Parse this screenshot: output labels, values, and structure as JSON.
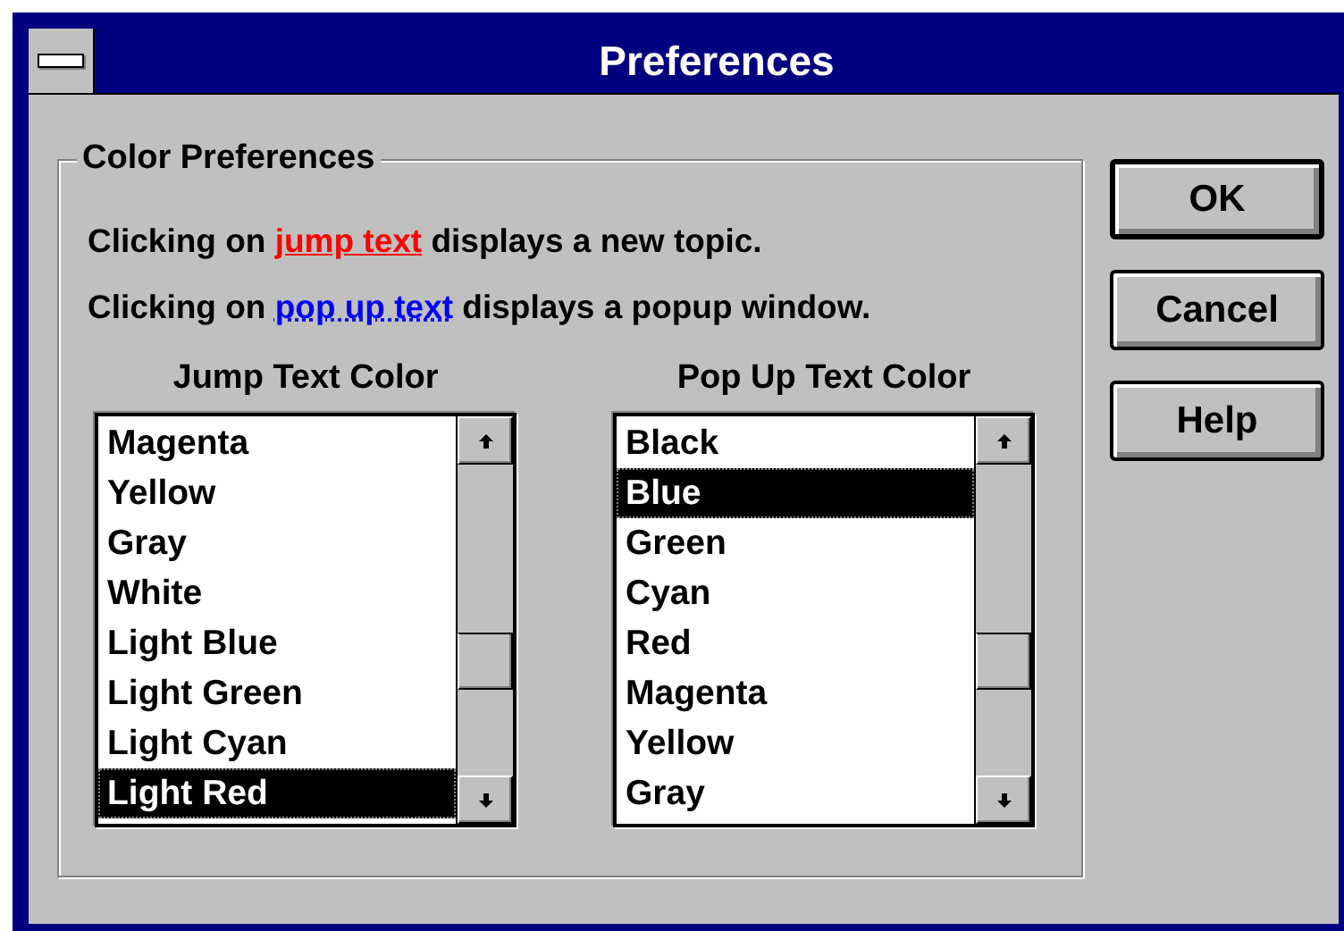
{
  "window": {
    "title": "Preferences"
  },
  "group": {
    "title": "Color Preferences"
  },
  "lines": [
    {
      "kind": "jump",
      "before": "Clicking on ",
      "link": "jump text",
      "after": " displays a new topic.",
      "color": "#ff0000"
    },
    {
      "kind": "popup",
      "before": "Clicking on ",
      "link": "pop up text",
      "after": " displays a popup window.",
      "color": "#0000ff"
    }
  ],
  "lists": [
    {
      "label": "Jump Text Color",
      "items": [
        {
          "label": "Magenta",
          "selected": false
        },
        {
          "label": "Yellow",
          "selected": false
        },
        {
          "label": "Gray",
          "selected": false
        },
        {
          "label": "White",
          "selected": false
        },
        {
          "label": "Light Blue",
          "selected": false
        },
        {
          "label": "Light Green",
          "selected": false
        },
        {
          "label": "Light Cyan",
          "selected": false
        },
        {
          "label": "Light Red",
          "selected": true
        }
      ]
    },
    {
      "label": "Pop Up Text Color",
      "items": [
        {
          "label": "Black",
          "selected": false
        },
        {
          "label": "Blue",
          "selected": true
        },
        {
          "label": "Green",
          "selected": false
        },
        {
          "label": "Cyan",
          "selected": false
        },
        {
          "label": "Red",
          "selected": false
        },
        {
          "label": "Magenta",
          "selected": false
        },
        {
          "label": "Yellow",
          "selected": false
        },
        {
          "label": "Gray",
          "selected": false
        }
      ]
    }
  ],
  "buttons": [
    {
      "label": "OK",
      "default": true
    },
    {
      "label": "Cancel",
      "default": false
    },
    {
      "label": "Help",
      "default": false
    }
  ]
}
